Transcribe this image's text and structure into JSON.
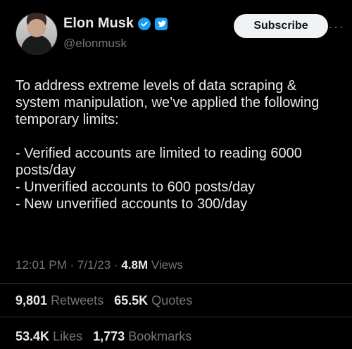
{
  "author": {
    "name": "Elon Musk",
    "handle": "@elonmusk"
  },
  "actions": {
    "subscribe_label": "Subscribe",
    "more_label": "···"
  },
  "tweet": {
    "text": "To address extreme levels of data scraping & system manipulation, we’ve applied the following temporary limits:\n\n- Verified accounts are limited to reading 6000 posts/day\n- Unverified accounts to 600 posts/day\n- New unverified accounts to 300/day"
  },
  "meta": {
    "time": "12:01 PM",
    "date": "7/1/23",
    "sep": "·",
    "views_count": "4.8M",
    "views_label": "Views"
  },
  "stats": {
    "retweets_count": "9,801",
    "retweets_label": "Retweets",
    "quotes_count": "65.5K",
    "quotes_label": "Quotes",
    "likes_count": "53.4K",
    "likes_label": "Likes",
    "bookmarks_count": "1,773",
    "bookmarks_label": "Bookmarks"
  },
  "colors": {
    "background": "#000000",
    "text": "#e7e9ea",
    "muted": "#71767b",
    "accent": "#1d9bf0"
  },
  "icons": {
    "verified": "verified-badge-icon",
    "twitter": "twitter-bird-icon",
    "more": "more-horizontal-icon"
  }
}
